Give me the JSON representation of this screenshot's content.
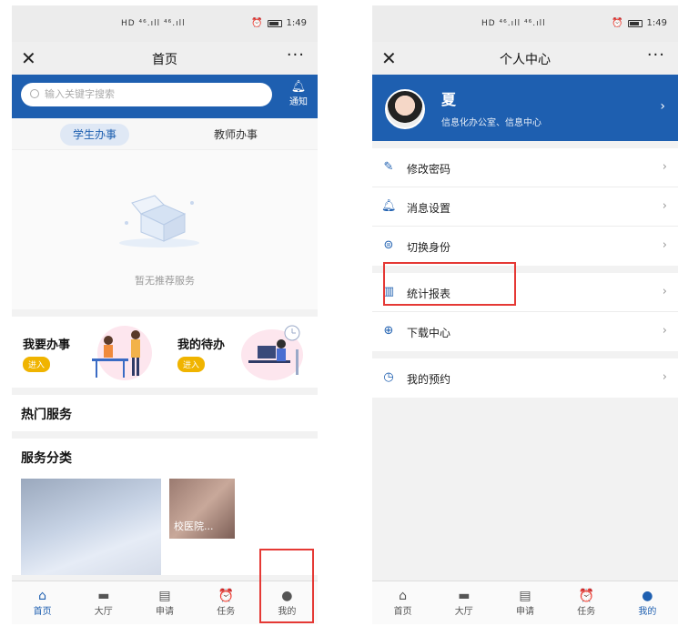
{
  "status": {
    "time": "1:49",
    "signal": "HD ⁴⁶.ıll ⁴⁶.ıll"
  },
  "left": {
    "title": "首页",
    "close_glyph": "✕",
    "more_glyph": "···",
    "search": {
      "placeholder": "输入关键字搜索",
      "notify_label": "通知"
    },
    "tabs": [
      "学生办事",
      "教师办事"
    ],
    "empty_text": "暂无推荐服务",
    "quick": [
      {
        "title": "我要办事",
        "action": "进入"
      },
      {
        "title": "我的待办",
        "action": "进入"
      }
    ],
    "hot_title": "热门服务",
    "cat_title": "服务分类",
    "cat_tile_label": "校医院..."
  },
  "right": {
    "title": "个人中心",
    "close_glyph": "✕",
    "more_glyph": "···",
    "user": {
      "name": "夏",
      "dept": "信息化办公室、信息中心"
    },
    "menu_group1": [
      "修改密码",
      "消息设置",
      "切换身份"
    ],
    "menu_group2": [
      "统计报表",
      "下载中心"
    ],
    "menu_group3": [
      "我的预约"
    ]
  },
  "tabbar": [
    "首页",
    "大厅",
    "申请",
    "任务",
    "我的"
  ],
  "colors": {
    "brand": "#1e5fb0",
    "highlight": "#e53935",
    "badge": "#f0b400"
  },
  "icons": {
    "tabbar": [
      "home-icon",
      "hall-icon",
      "document-icon",
      "alarm-icon",
      "user-icon"
    ],
    "menu": [
      "edit-icon",
      "bell-icon",
      "switch-icon",
      "chart-icon",
      "download-icon",
      "clock-icon"
    ]
  }
}
